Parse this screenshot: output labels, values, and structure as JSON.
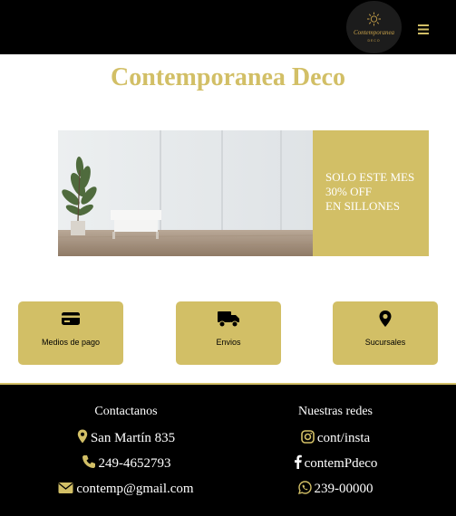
{
  "colors": {
    "accent": "#d2bf66",
    "bar": "#000000",
    "text_on_dark": "#ffffff"
  },
  "header": {
    "logo": {
      "text": "Contemporanea",
      "subtext": "DECO",
      "icon": "sun-logo-icon"
    },
    "menu_icon": "hamburger-menu-icon"
  },
  "page": {
    "title": "Contemporanea Deco"
  },
  "banner": {
    "promo_lines": [
      "SOLO ESTE MES",
      "30% OFF",
      "EN SILLONES"
    ]
  },
  "cards": [
    {
      "icon": "credit-card-icon",
      "label": "Medios de pago"
    },
    {
      "icon": "truck-icon",
      "label": "Envios"
    },
    {
      "icon": "map-pin-icon",
      "label": "Sucursales"
    }
  ],
  "footer": {
    "contact": {
      "heading": "Contactanos",
      "items": [
        {
          "icon": "map-pin-icon",
          "text": "San Martín 835"
        },
        {
          "icon": "phone-icon",
          "text": "249-4652793"
        },
        {
          "icon": "envelope-icon",
          "text": "contemp@gmail.com"
        }
      ]
    },
    "social": {
      "heading": "Nuestras redes",
      "items": [
        {
          "icon": "instagram-icon",
          "text": "cont/insta"
        },
        {
          "icon": "facebook-icon",
          "text": "contemPdeco"
        },
        {
          "icon": "whatsapp-icon",
          "text": "239-00000"
        }
      ]
    }
  }
}
